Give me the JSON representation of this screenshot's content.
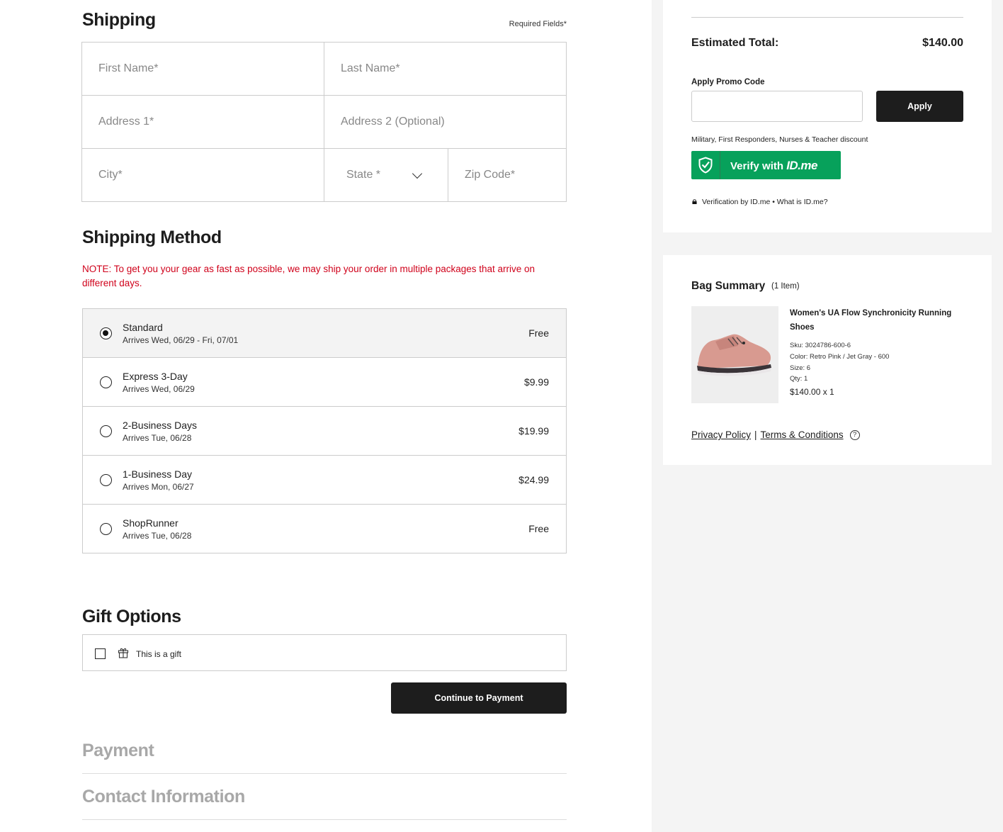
{
  "shipping": {
    "title": "Shipping",
    "required_note": "Required Fields*",
    "fields": {
      "first_name": "First Name*",
      "last_name": "Last Name*",
      "address1": "Address 1*",
      "address2": "Address 2 (Optional)",
      "city": "City*",
      "state": "State *",
      "zip": "Zip Code*"
    }
  },
  "shipping_method": {
    "title": "Shipping Method",
    "note": "NOTE: To get you your gear as fast as possible, we may ship your order in multiple packages that arrive on different days.",
    "options": [
      {
        "name": "Standard",
        "arrives": "Arrives Wed, 06/29 - Fri, 07/01",
        "price": "Free",
        "selected": true
      },
      {
        "name": "Express 3-Day",
        "arrives": "Arrives Wed, 06/29",
        "price": "$9.99",
        "selected": false
      },
      {
        "name": "2-Business Days",
        "arrives": "Arrives Tue, 06/28",
        "price": "$19.99",
        "selected": false
      },
      {
        "name": "1-Business Day",
        "arrives": "Arrives Mon, 06/27",
        "price": "$24.99",
        "selected": false
      },
      {
        "name": "ShopRunner",
        "arrives": "Arrives Tue, 06/28",
        "price": "Free",
        "selected": false
      }
    ]
  },
  "gift": {
    "title": "Gift Options",
    "label": "This is a gift",
    "checked": false
  },
  "continue_label": "Continue to Payment",
  "collapsed_sections": [
    "Payment",
    "Contact Information"
  ],
  "summary": {
    "estimated_label": "Estimated Total:",
    "estimated_value": "$140.00",
    "promo_label": "Apply Promo Code",
    "promo_value": "",
    "apply_label": "Apply",
    "military_text": "Military, First Responders, Nurses & Teacher discount",
    "idme_prefix": "Verify with",
    "idme_brand": "ID.me",
    "verification_text": "Verification by ID.me • What is ID.me?"
  },
  "bag": {
    "title": "Bag Summary",
    "count": "(1 Item)",
    "product": {
      "name": "Women's UA Flow Synchronicity Running Shoes",
      "sku": "Sku: 3024786-600-6",
      "color": "Color: Retro Pink / Jet Gray - 600",
      "size": "Size: 6",
      "qty": "Qty: 1",
      "price": "$140.00 x 1"
    }
  },
  "footer_links": {
    "privacy": "Privacy Policy",
    "separator": "|",
    "terms": "Terms & Conditions",
    "help_icon": "?"
  },
  "colors": {
    "accent_dark": "#1d1d1d",
    "note_red": "#d0021b",
    "idme_green": "#07a15b",
    "panel_bg": "#f4f4f4"
  }
}
